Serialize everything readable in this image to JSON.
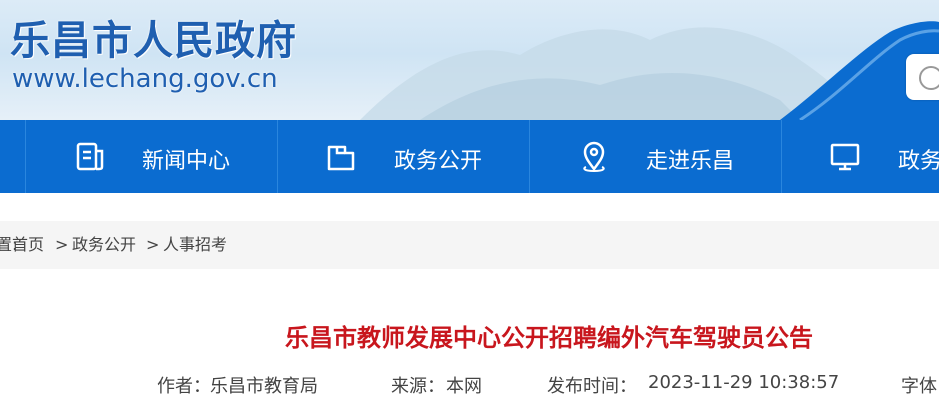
{
  "header": {
    "site_title": "乐昌市人民政府",
    "site_url": "www.lechang.gov.cn"
  },
  "nav": {
    "items": [
      {
        "label": "新闻中心",
        "icon": "news-document-icon"
      },
      {
        "label": "政务公开",
        "icon": "folder-icon"
      },
      {
        "label": "走进乐昌",
        "icon": "location-pin-icon"
      },
      {
        "label": "政务",
        "icon": "monitor-icon"
      }
    ]
  },
  "breadcrumb": {
    "prefix": "置:",
    "items": [
      "首页",
      "政务公开",
      "人事招考"
    ],
    "separator": ">"
  },
  "article": {
    "title": "乐昌市教师发展中心公开招聘编外汽车驾驶员公告",
    "author_label": "作者：",
    "author": "乐昌市教育局",
    "source_label": "来源：",
    "source": "本网",
    "published_label": "发布时间：",
    "published": "2023-11-29 10:38:57",
    "font_label": "字体"
  },
  "colors": {
    "nav_bg": "#0b6cd0",
    "title_red": "#c8161d",
    "brand_blue": "#1f5fb0"
  }
}
